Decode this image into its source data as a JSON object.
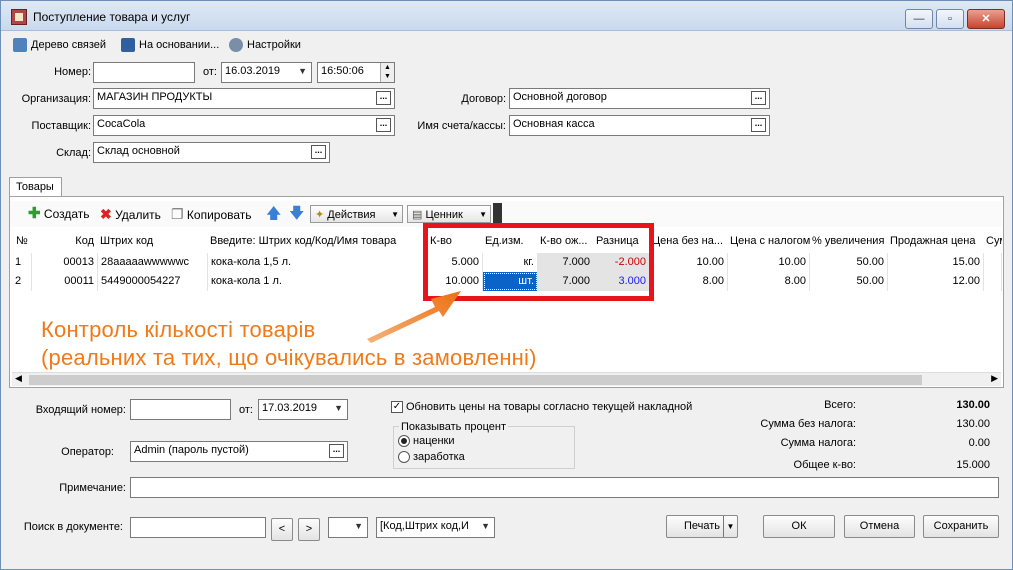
{
  "window": {
    "title": "Поступление товара и услуг",
    "min": "—",
    "max": "▫",
    "close": "✕"
  },
  "toolbar_top": {
    "links": "Дерево связей",
    "based_on": "На основании...",
    "settings": "Настройки"
  },
  "header": {
    "number_label": "Номер:",
    "number_value": "",
    "from_label": "от:",
    "date_value": "16.03.2019",
    "time_value": "16:50:06",
    "org_label": "Организация:",
    "org_value": "МАГАЗИН ПРОДУКТЫ",
    "supplier_label": "Поставщик:",
    "supplier_value": "CocaCola",
    "warehouse_label": "Склад:",
    "warehouse_value": "Склад основной",
    "contract_label": "Договор:",
    "contract_value": "Основной договор",
    "account_label": "Имя счета/кассы:",
    "account_value": "Основная касса",
    "dots": "..."
  },
  "tabs": {
    "goods": "Товары"
  },
  "items_toolbar": {
    "create": "Создать",
    "delete": "Удалить",
    "copy": "Копировать",
    "actions": "Действия",
    "price_tag": "Ценник"
  },
  "grid": {
    "headers": [
      "№",
      "Код",
      "Штрих код",
      "Введите: Штрих код/Код/Имя товара",
      "К-во",
      "Ед.изм.",
      "К-во ож...",
      "Разница",
      "Цена без на...",
      "Цена с налогом",
      "% увеличения",
      "Продажная цена",
      "Сум"
    ],
    "rows": [
      [
        "1",
        "00013",
        "28aaaaawwwwwc",
        "кока-кола 1,5 л.",
        "5.000",
        "кг.",
        "7.000",
        "-2.000",
        "10.00",
        "10.00",
        "50.00",
        "15.00",
        ""
      ],
      [
        "2",
        "00011",
        "5449000054227",
        "кока-кола 1 л.",
        "10.000",
        "шт.",
        "7.000",
        "3.000",
        "8.00",
        "8.00",
        "50.00",
        "12.00",
        ""
      ]
    ]
  },
  "annotation": {
    "line1": "Контроль кількості товарів",
    "line2": "(реальних та тих, що очікувались в замовленні)",
    "color": "#f07a1a"
  },
  "footer": {
    "incoming_label": "Входящий номер:",
    "incoming_value": "",
    "from_label": "от:",
    "incoming_date": "17.03.2019",
    "update_prices": "Обновить цены на товары согласно текущей накладной",
    "show_percent": "Показывать процент",
    "markup": "наценки",
    "profit": "заработка",
    "operator_label": "Оператор:",
    "operator_value": "Admin (пароль пустой)",
    "note_label": "Примечание:",
    "note_value": "",
    "total_label": "Всего:",
    "total_value": "130.00",
    "no_tax_label": "Сумма без налога:",
    "no_tax_value": "130.00",
    "tax_label": "Сумма налога:",
    "tax_value": "0.00",
    "qty_label": "Общее к-во:",
    "qty_value": "15.000"
  },
  "bottom": {
    "search_label": "Поиск в документе:",
    "search_value": "",
    "prev": "<",
    "next": ">",
    "search_fields": "[Код,Штрих код,И",
    "print": "Печать",
    "ok": "ОК",
    "cancel": "Отмена",
    "save": "Сохранить"
  }
}
